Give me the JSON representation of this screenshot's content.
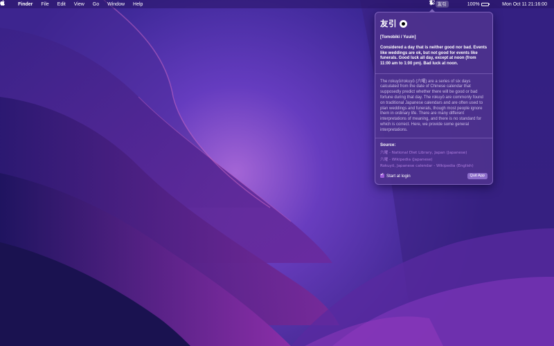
{
  "menubar": {
    "apple_icon": "apple-logo-icon",
    "app_name": "Finder",
    "menus": [
      "File",
      "Edit",
      "View",
      "Go",
      "Window",
      "Help"
    ],
    "status_app_label": "友引",
    "bluetooth_icon": "bluetooth-icon",
    "focus_icon": "moon-icon",
    "battery_percent": "100%",
    "battery_level": 1.0,
    "control_center_icon": "control-center-icon",
    "datetime": "Mon Oct 11  21:16:00"
  },
  "popover": {
    "title": "友引",
    "symbol_icon": "filled-circle-dot-icon",
    "reading": "[Tomobiki / Yuuin]",
    "meaning": "Considered a day that is neither good nor bad. Events like weddings are ok, but not good for events like funerals. Good luck all day, except at noon (from 11:00 am to 1:00 pm). Bad luck at noon.",
    "explanation": "The rokuyō/rokuyō (六曜) are a series of six days calculated from the date of Chinese calendar that supposedly predict whether there will be good or bad fortune during that day. The rokuyō are commonly found on traditional Japanese calendars and are often used to plan weddings and funerals, though most people ignore them in ordinary life. There are many different interpretations of meaning, and there is no standard for which is correct. Here, we provide some general interpretations.",
    "source_label": "Source:",
    "sources": [
      "六曜 - National Diet Library, Japan (Japanese)",
      "六曜 - Wikipedia (Japanese)",
      "Rokuyō, Japanese calendar - Wikipedia (English)"
    ],
    "start_at_login_label": "Start at login",
    "start_at_login_checked": true,
    "quit_label": "Quit App"
  },
  "colors": {
    "wallpaper_base": "#2a1a6e",
    "popover_bg": "#4e328e",
    "link": "#b07fe0",
    "accent": "#9c5cd8"
  }
}
